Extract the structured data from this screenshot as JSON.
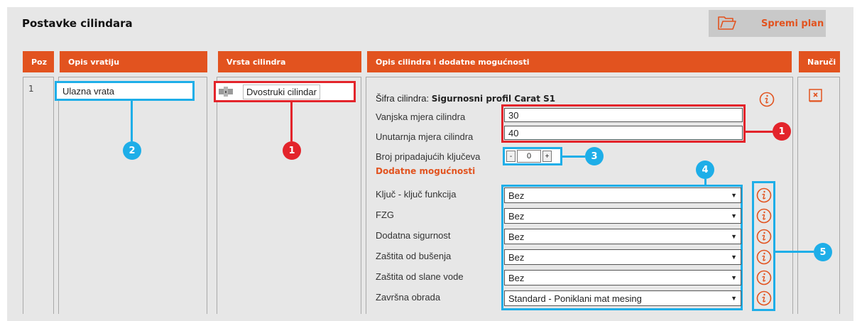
{
  "title": "Postavke cilindara",
  "save_button": {
    "label": "Spremi plan",
    "icon": "folder-open-icon"
  },
  "table": {
    "headers": {
      "poz": "Poz",
      "door": "Opis vratiju",
      "type": "Vrsta cilindra",
      "desc": "Opis cilindra i dodatne mogućnosti",
      "order": "Naruči"
    },
    "row": {
      "poz": "1",
      "door_value": "Ulazna vrata",
      "cylinder_type": "Dvostruki cilindar",
      "code_label": "Šifra cilindra:",
      "code_value": "Sigurnosni profil Carat S1",
      "outer_label": "Vanjska mjera cilindra",
      "outer_value": "30",
      "inner_label": "Unutarnja mjera cilindra",
      "inner_value": "40",
      "keys_label": "Broj pripadajućih ključeva",
      "keys_minus": "-",
      "keys_value": "0",
      "keys_plus": "+",
      "extras_title": "Dodatne mogućnosti",
      "options": [
        {
          "label": "Ključ - ključ funkcija",
          "value": "Bez"
        },
        {
          "label": "FZG",
          "value": "Bez"
        },
        {
          "label": "Dodatna sigurnost",
          "value": "Bez"
        },
        {
          "label": "Zaštita od bušenja",
          "value": "Bez"
        },
        {
          "label": "Zaštita od slane vode",
          "value": "Bez"
        },
        {
          "label": "Završna obrada",
          "value": "Standard - Poniklani mat mesing"
        }
      ]
    }
  },
  "callouts": {
    "c1": "1",
    "c1b": "1",
    "c2": "2",
    "c3": "3",
    "c4": "4",
    "c5": "5"
  },
  "colors": {
    "accent": "#e2531f",
    "callout_red": "#e3242b",
    "callout_blue": "#1eaee8",
    "panel": "#e7e7e7"
  }
}
